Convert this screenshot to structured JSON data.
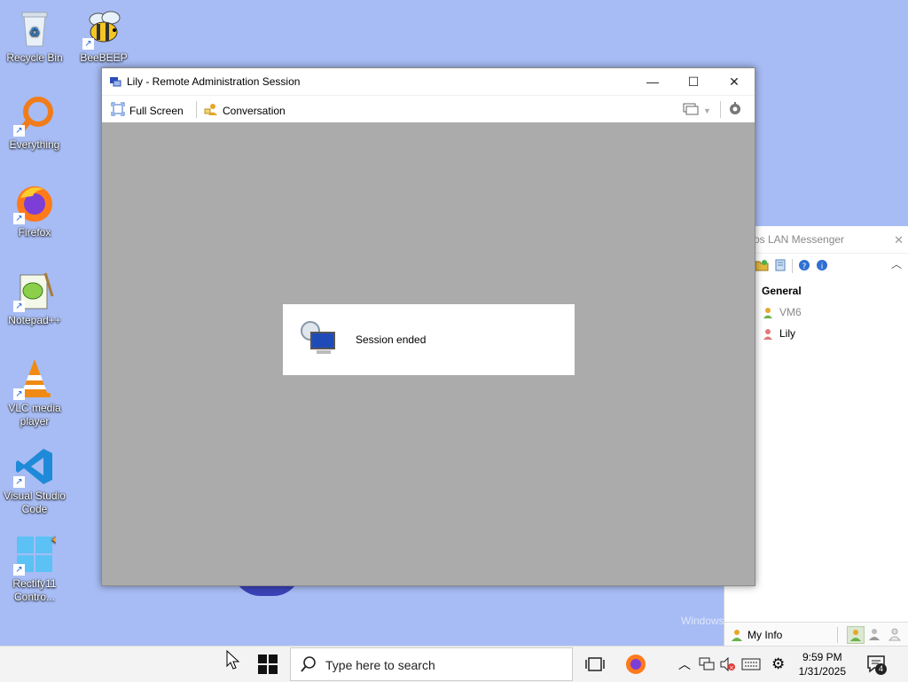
{
  "desktop": {
    "icons": [
      {
        "label": "Recycle Bin"
      },
      {
        "label": "BeeBEEP"
      },
      {
        "label": "Everything"
      },
      {
        "label": "Firefox"
      },
      {
        "label": "Notepad++"
      },
      {
        "label": "VLC media player"
      },
      {
        "label": "Visual Studio Code"
      },
      {
        "label": "Rectify11 Contro..."
      }
    ],
    "watermark": "Windows"
  },
  "messenger": {
    "title": "os LAN Messenger",
    "group": "General",
    "users": [
      {
        "name": "VM6",
        "status_color": "#e6a72b"
      },
      {
        "name": "Lily",
        "status_color": "#e07a7a"
      }
    ],
    "my_info": "My Info"
  },
  "session_window": {
    "title": "Lily - Remote Administration Session",
    "toolbar": {
      "full_screen": "Full Screen",
      "conversation": "Conversation"
    },
    "dialog_message": "Session ended"
  },
  "taskbar": {
    "search_placeholder": "Type here to search",
    "time": "9:59 PM",
    "date": "1/31/2025",
    "notification_count": "4"
  },
  "colors": {
    "desktop_bg": "#a7bcf4",
    "viewport_bg": "#ababab",
    "accent": "#0078d4"
  }
}
